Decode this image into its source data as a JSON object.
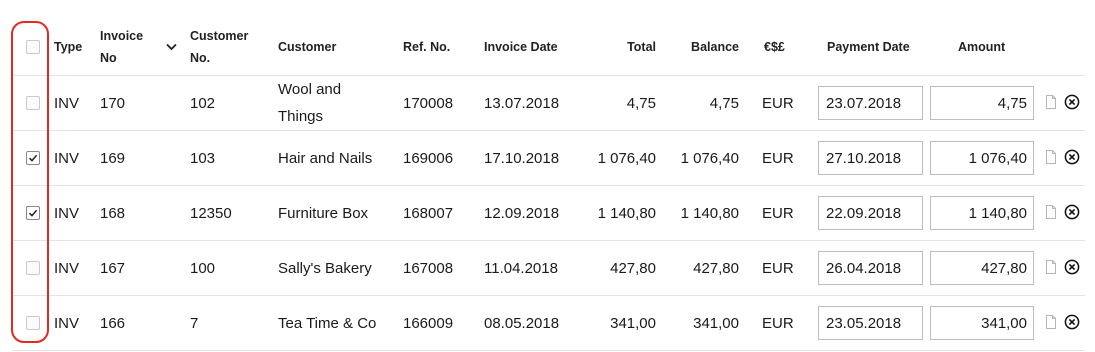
{
  "header": {
    "type": "Type",
    "invoice_no_line1": "Invoice",
    "invoice_no_line2": "No",
    "customer_no_line1": "Customer",
    "customer_no_line2": "No.",
    "customer": "Customer",
    "ref_no": "Ref. No.",
    "invoice_date": "Invoice Date",
    "total": "Total",
    "balance": "Balance",
    "currency": "€$£",
    "payment_date": "Payment Date",
    "amount": "Amount"
  },
  "rows": [
    {
      "checked": false,
      "type": "INV",
      "invoice_no": "170",
      "customer_no": "102",
      "customer_line1": "Wool and",
      "customer_line2": "Things",
      "ref_no": "170008",
      "invoice_date": "13.07.2018",
      "total": "4,75",
      "balance": "4,75",
      "currency": "EUR",
      "payment_date": "23.07.2018",
      "amount": "4,75"
    },
    {
      "checked": true,
      "type": "INV",
      "invoice_no": "169",
      "customer_no": "103",
      "customer_line1": "Hair and Nails",
      "customer_line2": "",
      "ref_no": "169006",
      "invoice_date": "17.10.2018",
      "total": "1 076,40",
      "balance": "1 076,40",
      "currency": "EUR",
      "payment_date": "27.10.2018",
      "amount": "1 076,40"
    },
    {
      "checked": true,
      "type": "INV",
      "invoice_no": "168",
      "customer_no": "12350",
      "customer_line1": "Furniture Box",
      "customer_line2": "",
      "ref_no": "168007",
      "invoice_date": "12.09.2018",
      "total": "1 140,80",
      "balance": "1 140,80",
      "currency": "EUR",
      "payment_date": "22.09.2018",
      "amount": "1 140,80"
    },
    {
      "checked": false,
      "type": "INV",
      "invoice_no": "167",
      "customer_no": "100",
      "customer_line1": "Sally's Bakery",
      "customer_line2": "",
      "ref_no": "167008",
      "invoice_date": "11.04.2018",
      "total": "427,80",
      "balance": "427,80",
      "currency": "EUR",
      "payment_date": "26.04.2018",
      "amount": "427,80"
    },
    {
      "checked": false,
      "type": "INV",
      "invoice_no": "166",
      "customer_no": "7",
      "customer_line1": "Tea Time & Co",
      "customer_line2": "",
      "ref_no": "166009",
      "invoice_date": "08.05.2018",
      "total": "341,00",
      "balance": "341,00",
      "currency": "EUR",
      "payment_date": "23.05.2018",
      "amount": "341,00"
    }
  ],
  "icons": {
    "sort": "chevron-down-icon",
    "document": "document-icon",
    "remove": "circle-x-icon"
  },
  "colors": {
    "highlight": "#e22b20",
    "border": "#e3e3e3",
    "input_border": "#bdbdbd"
  }
}
